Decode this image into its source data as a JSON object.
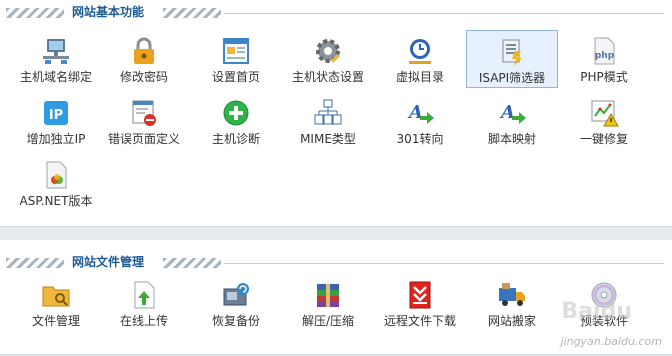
{
  "sections": {
    "basic": {
      "title": "网站基本功能",
      "items": [
        {
          "label": "主机域名绑定",
          "icon": "network-computer-icon"
        },
        {
          "label": "修改密码",
          "icon": "padlock-icon"
        },
        {
          "label": "设置首页",
          "icon": "webpage-icon"
        },
        {
          "label": "主机状态设置",
          "icon": "gear-icon"
        },
        {
          "label": "虚拟目录",
          "icon": "globe-clock-icon"
        },
        {
          "label": "ISAPI筛选器",
          "icon": "filter-document-icon"
        },
        {
          "label": "PHP模式",
          "icon": "php-file-icon"
        },
        {
          "label": "增加独立IP",
          "icon": "ip-badge-icon"
        },
        {
          "label": "错误页面定义",
          "icon": "error-page-icon"
        },
        {
          "label": "主机诊断",
          "icon": "plus-circle-icon"
        },
        {
          "label": "MIME类型",
          "icon": "mime-tree-icon"
        },
        {
          "label": "301转向",
          "icon": "redirect-arrow-icon"
        },
        {
          "label": "脚本映射",
          "icon": "script-mapping-icon"
        },
        {
          "label": "一键修复",
          "icon": "repair-warning-icon"
        },
        {
          "label": "ASP.NET版本",
          "icon": "aspnet-file-icon"
        }
      ]
    },
    "files": {
      "title": "网站文件管理",
      "items": [
        {
          "label": "文件管理",
          "icon": "folder-search-icon"
        },
        {
          "label": "在线上传",
          "icon": "upload-file-icon"
        },
        {
          "label": "恢复备份",
          "icon": "restore-backup-icon"
        },
        {
          "label": "解压/压缩",
          "icon": "archive-icon"
        },
        {
          "label": "远程文件下载",
          "icon": "download-icon"
        },
        {
          "label": "网站搬家",
          "icon": "moving-truck-icon"
        },
        {
          "label": "预装软件",
          "icon": "software-cd-icon"
        }
      ]
    }
  },
  "selected_item": "ISAPI筛选器",
  "watermark": "jingyan.baidu.com",
  "watermark_logo": "Baidu",
  "colors": {
    "title": "#1d5a97",
    "selected_bg": "#e6f1fd",
    "selected_border": "#8fb6e0"
  }
}
